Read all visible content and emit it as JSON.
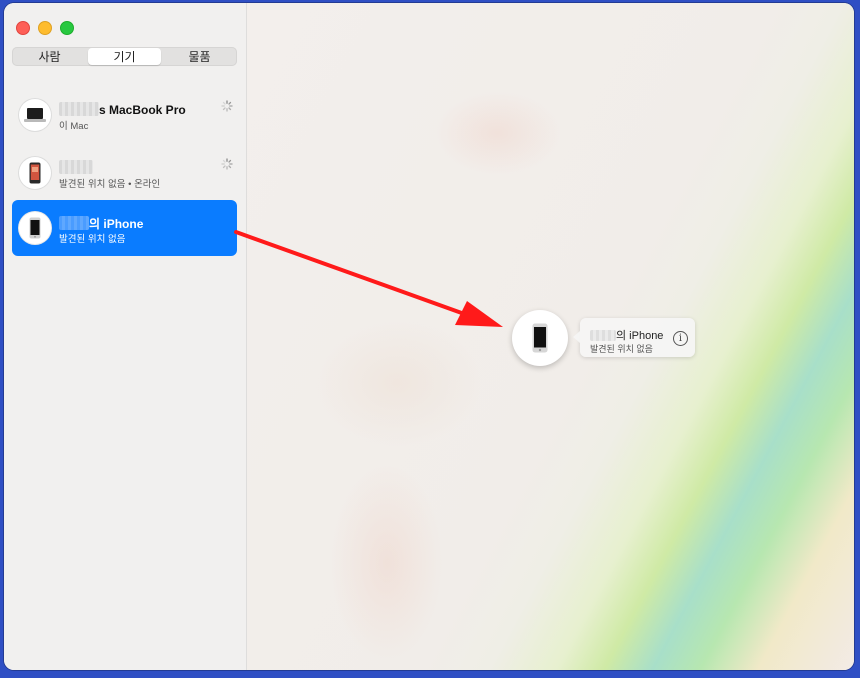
{
  "window": {
    "traffic_lights": [
      "close",
      "minimize",
      "zoom"
    ]
  },
  "tabs": [
    {
      "label": "사람",
      "active": false
    },
    {
      "label": "기기",
      "active": true
    },
    {
      "label": "물품",
      "active": false
    }
  ],
  "devices": [
    {
      "name_suffix": "s MacBook Pro",
      "subtitle": "이 Mac",
      "icon": "laptop-icon",
      "loading": true,
      "selected": false
    },
    {
      "name_suffix": "",
      "subtitle": "발견된 위치 없음 • 온라인",
      "icon": "phone-icon",
      "loading": true,
      "selected": false
    },
    {
      "name_suffix": "의 iPhone",
      "subtitle": "발견된 위치 없음",
      "icon": "iphone-icon",
      "loading": false,
      "selected": true
    }
  ],
  "map_callout": {
    "name_suffix": "의 iPhone",
    "subtitle": "발견된 위치 없음",
    "info_icon": "i"
  },
  "colors": {
    "selection": "#0a7cff",
    "desktop": "#2f4fc4",
    "annotation_arrow": "#ff1a1a"
  }
}
